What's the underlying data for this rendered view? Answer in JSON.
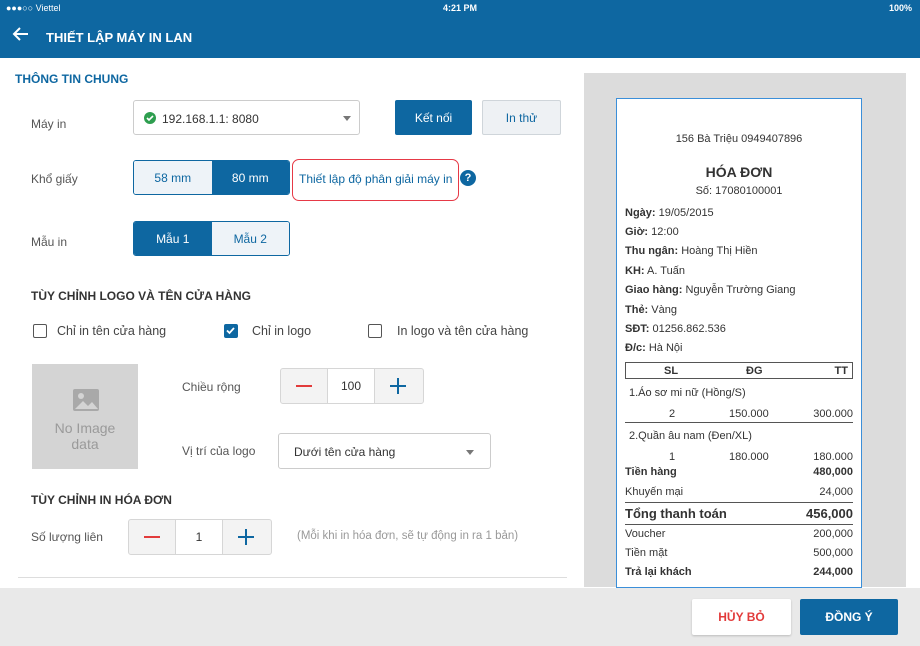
{
  "status": {
    "carrier": "●●●○○ Viettel",
    "time": "4:21 PM",
    "battery": "100%"
  },
  "header": {
    "title": "THIẾT LẬP MÁY IN LAN"
  },
  "general": {
    "section_title": "THÔNG TIN CHUNG",
    "printer_label": "Máy in",
    "printer_value": "192.168.1.1: 8080",
    "connect_button": "Kết nối",
    "test_button": "In thử",
    "paper_label": "Khổ giấy",
    "paper_58": "58 mm",
    "paper_80": "80 mm",
    "resolution_link": "Thiết lập độ phân giải máy in",
    "help": "?",
    "template_label": "Mẫu in",
    "template_1": "Mẫu 1",
    "template_2": "Mẫu 2"
  },
  "logo": {
    "section_title": "TÙY CHỈNH LOGO VÀ TÊN CỬA HÀNG",
    "opt_store_name": "Chỉ in tên cửa hàng",
    "opt_logo": "Chỉ in logo",
    "opt_both": "In logo và tên cửa hàng",
    "no_image": "No Image data",
    "width_label": "Chiều rộng",
    "width_value": "100",
    "position_label": "Vị trí của logo",
    "position_value": "Dưới tên cửa hàng"
  },
  "invoice": {
    "section_title": "TÙY CHỈNH IN HÓA ĐƠN",
    "copies_label": "Số lượng liên",
    "copies_value": "1",
    "copies_hint": "(Mỗi khi in hóa đơn, sẽ tự động in ra 1 bản)"
  },
  "receipt": {
    "address": "156 Bà Triệu 0949407896",
    "title": "HÓA ĐƠN",
    "number": "Số: 17080100001",
    "info": [
      {
        "k": "Ngày:",
        "v": "19/05/2015"
      },
      {
        "k": "Giờ:",
        "v": "12:00"
      },
      {
        "k": "Thu ngân:",
        "v": "Hoàng Thị Hiền"
      },
      {
        "k": "KH:",
        "v": "A. Tuấn"
      },
      {
        "k": "Giao hàng:",
        "v": "Nguyễn Trường Giang"
      },
      {
        "k": "Thẻ:",
        "v": "Vàng"
      },
      {
        "k": "SĐT:",
        "v": "01256.862.536"
      },
      {
        "k": "Đ/c:",
        "v": "Hà Nội"
      }
    ],
    "col_sl": "SL",
    "col_dg": "ĐG",
    "col_tt": "TT",
    "items": [
      {
        "name": "1.Áo sơ mi nữ (Hồng/S)",
        "sl": "2",
        "dg": "150.000",
        "tt": "300.000"
      },
      {
        "name": "2.Quần âu nam (Đen/XL)",
        "sl": "1",
        "dg": "180.000",
        "tt": "180.000"
      }
    ],
    "subtotal_label": "Tiền hàng",
    "subtotal": "480,000",
    "discount_label": "Khuyến mại",
    "discount": "24,000",
    "total_label": "Tổng thanh toán",
    "total": "456,000",
    "voucher_label": "Voucher",
    "voucher": "200,000",
    "cash_label": "Tiền mặt",
    "cash": "500,000",
    "change_label": "Trả lại khách",
    "change": "244,000"
  },
  "footer": {
    "cancel": "HỦY BỎ",
    "ok": "ĐỒNG Ý"
  },
  "colors": {
    "primary": "#0e67a1",
    "danger": "#e23b3b",
    "highlight": "#e63946"
  }
}
